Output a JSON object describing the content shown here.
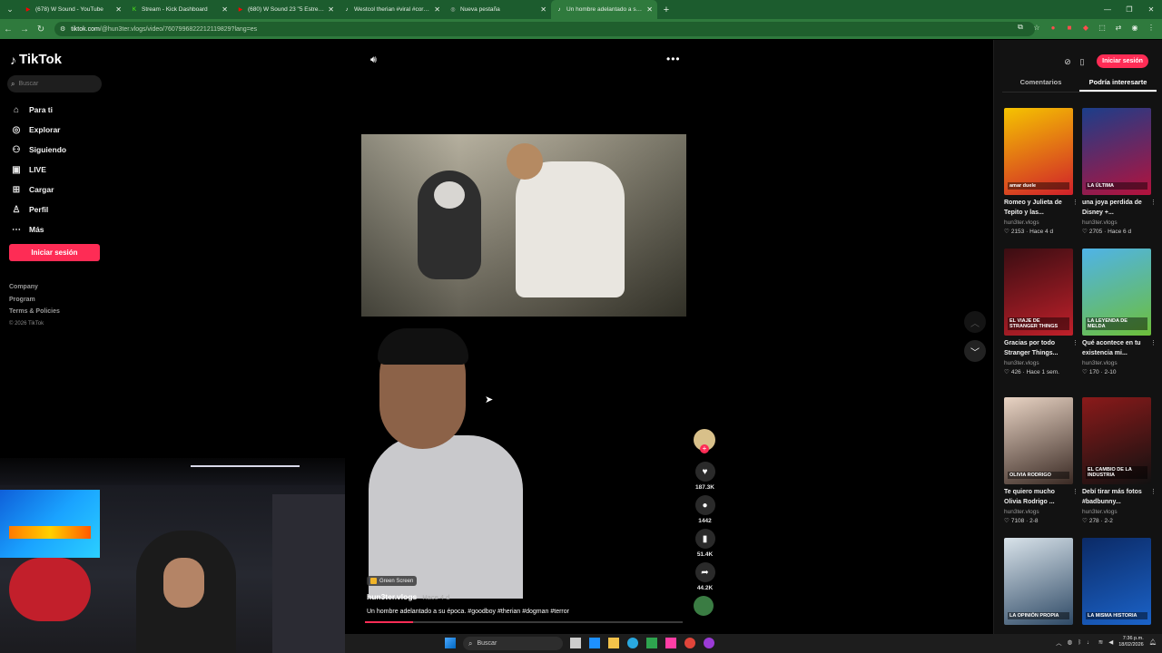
{
  "browser": {
    "tabs": [
      {
        "title": "(678) W Sound - YouTube",
        "icon": "youtube-icon",
        "color": "#ff0000"
      },
      {
        "title": "Stream - Kick Dashboard",
        "icon": "kick-icon",
        "color": "#53fc18"
      },
      {
        "title": "(680) W Sound 23 \"5 Estrellas\"",
        "icon": "youtube-icon",
        "color": "#ff0000"
      },
      {
        "title": "Westcol therian #viral #core #",
        "icon": "tiktok-icon",
        "color": "#ffffff"
      },
      {
        "title": "Nueva pestaña",
        "icon": "newtab-icon",
        "color": "#cccccc"
      },
      {
        "title": "Un hombre adelantado a su ép",
        "icon": "tiktok-icon",
        "color": "#ffffff"
      }
    ],
    "url_host": "tiktok.com",
    "url_path": "/@hun3ter.vlogs/video/7607996822212119829?lang=es"
  },
  "sidebar": {
    "logo": "TikTok",
    "search_placeholder": "Buscar",
    "items": [
      {
        "label": "Para ti",
        "icon": "home-icon"
      },
      {
        "label": "Explorar",
        "icon": "compass-icon"
      },
      {
        "label": "Siguiendo",
        "icon": "following-icon"
      },
      {
        "label": "LIVE",
        "icon": "live-icon"
      },
      {
        "label": "Cargar",
        "icon": "upload-icon"
      },
      {
        "label": "Perfil",
        "icon": "profile-icon"
      },
      {
        "label": "Más",
        "icon": "more-icon"
      }
    ],
    "login": "Iniciar sesión",
    "footer": [
      "Company",
      "Program",
      "Terms & Policies"
    ],
    "copyright": "© 2026 TikTok"
  },
  "video": {
    "effect_badge": "Green Screen",
    "author": "hun3ter.vlogs",
    "time_ago": "Hace 4 d",
    "caption": "Un hombre adelantado a su época. #goodboy #therian  #dogman #terror",
    "progress": 0.15,
    "likes": "187.3K",
    "comments": "1442",
    "saves": "51.4K",
    "shares": "44.2K"
  },
  "right_panel": {
    "login": "Iniciar sesión",
    "tabs": [
      "Comentarios",
      "Podría interesarte"
    ],
    "active_tab": 1,
    "cards": [
      {
        "title": "Romeo y Julieta de Tepito y las...",
        "user": "hun3ter.vlogs",
        "likes": "2153",
        "ago": "Hace 4 d",
        "thumb_text": "amar  duele",
        "c1": "#f5c400",
        "c2": "#d0202a"
      },
      {
        "title": "una joya perdida de Disney +...",
        "user": "hun3ter.vlogs",
        "likes": "2705",
        "ago": "Hace 6 d",
        "thumb_text": "LA ÚLTIMA",
        "c1": "#1b3e8a",
        "c2": "#b4123c"
      },
      {
        "title": "Gracias por todo Stranger Things...",
        "user": "hun3ter.vlogs",
        "likes": "426",
        "ago": "Hace 1 sem.",
        "thumb_text": "EL VIAJE DE STRANGER THINGS",
        "c1": "#3a0d12",
        "c2": "#c0202a"
      },
      {
        "title": "Qué acontece en tu existencia mi...",
        "user": "hun3ter.vlogs",
        "likes": "170",
        "ago": "2-10",
        "thumb_text": "LA LEYENDA DE MELDA",
        "c1": "#4fb3e8",
        "c2": "#6dbf3a"
      },
      {
        "title": "Te quiero mucho Olivia Rodrigo ...",
        "user": "hun3ter.vlogs",
        "likes": "7108",
        "ago": "2-8",
        "thumb_text": "OLIVIA RODRIGO",
        "c1": "#e9d4c4",
        "c2": "#3a2a24"
      },
      {
        "title": "Debí tirar más fotos #badbunny...",
        "user": "hun3ter.vlogs",
        "likes": "278",
        "ago": "2-2",
        "thumb_text": "EL CAMBIO DE LA INDUSTRIA",
        "c1": "#8b1a1a",
        "c2": "#111111"
      },
      {
        "title": "",
        "user": "",
        "likes": "",
        "ago": "",
        "thumb_text": "LA OPINIÓN PROPIA",
        "c1": "#d9e3ea",
        "c2": "#2f4a66"
      },
      {
        "title": "",
        "user": "",
        "likes": "",
        "ago": "",
        "thumb_text": "LA MISMA HISTORIA",
        "c1": "#0b2a66",
        "c2": "#1b63c9"
      }
    ]
  },
  "taskbar": {
    "search": "Buscar",
    "time": "7:36 p.m.",
    "date": "18/02/2026"
  }
}
